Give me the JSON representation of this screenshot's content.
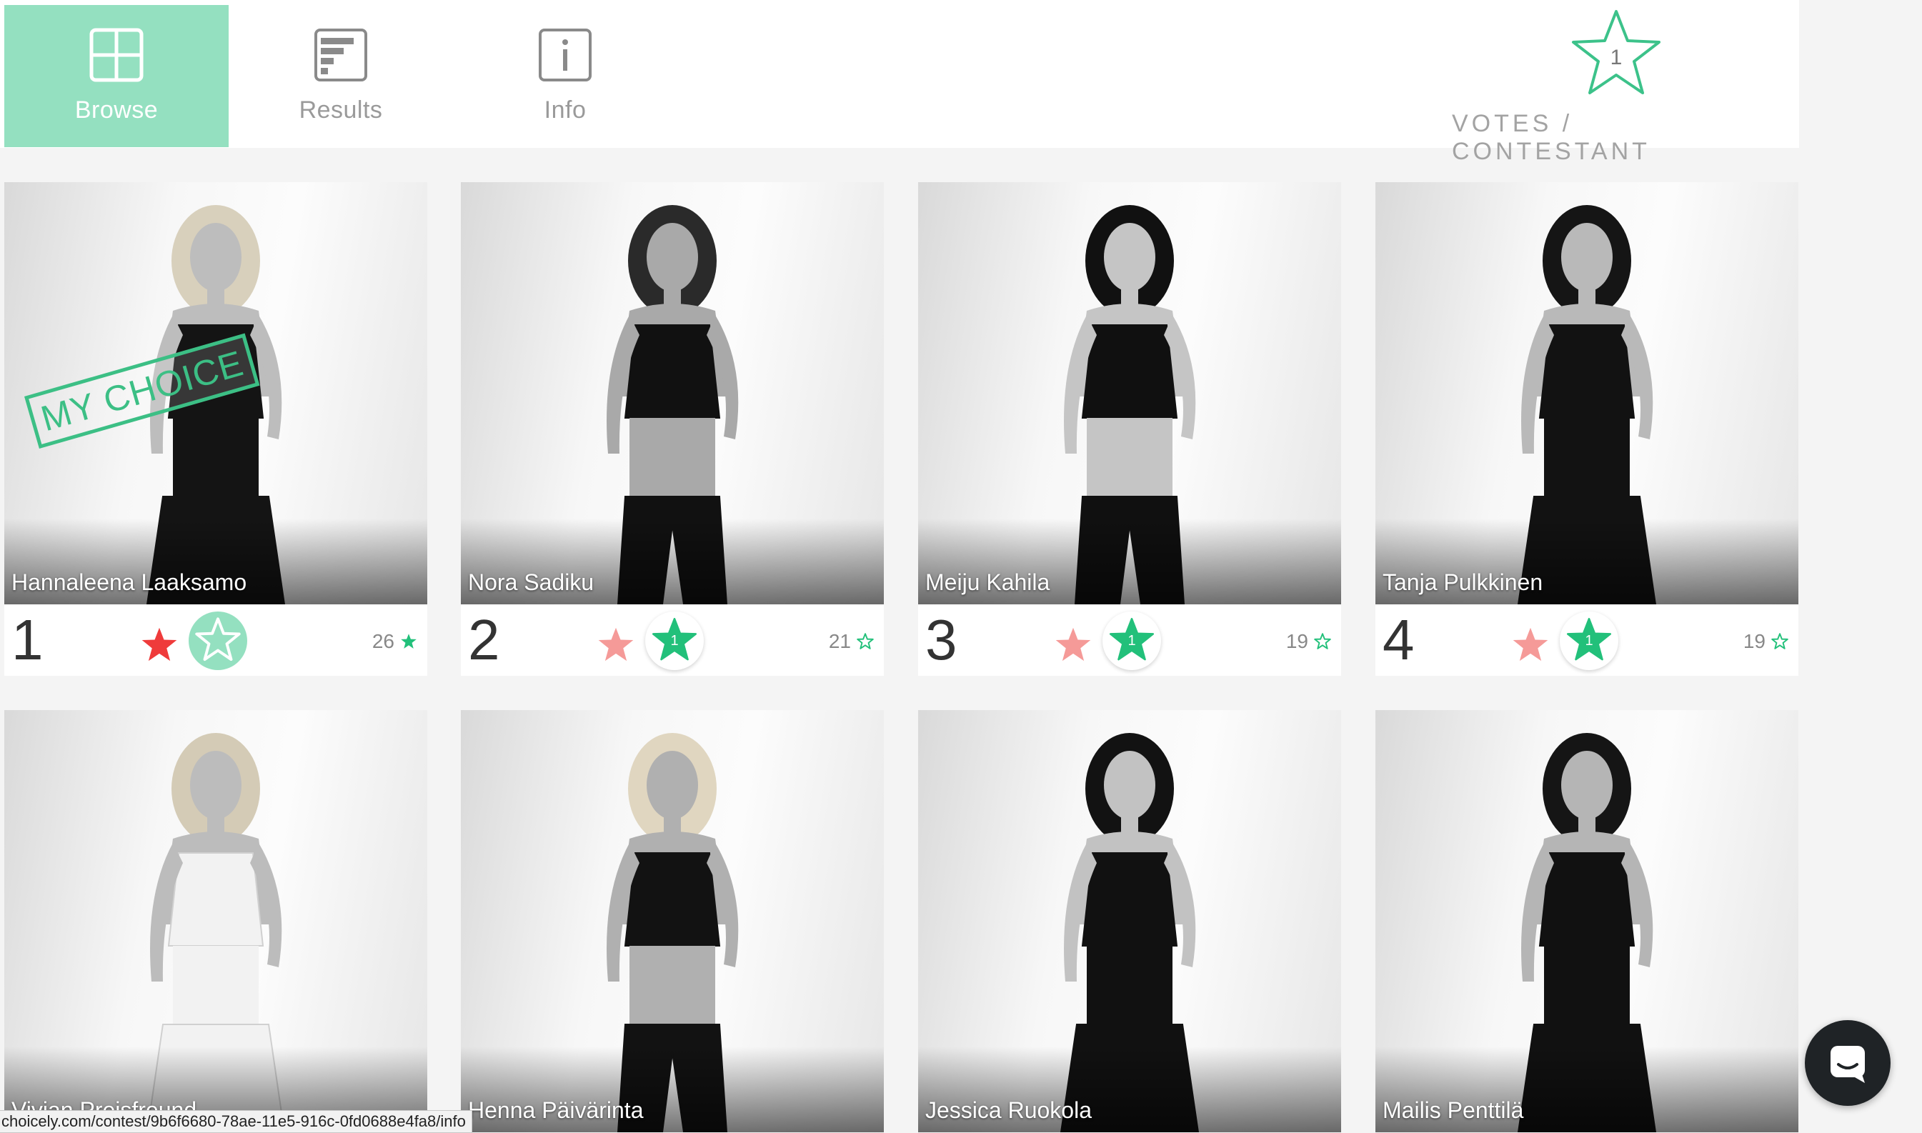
{
  "nav": {
    "tabs": [
      {
        "label": "Browse",
        "icon": "grid-icon",
        "active": true
      },
      {
        "label": "Results",
        "icon": "results-icon",
        "active": false
      },
      {
        "label": "Info",
        "icon": "info-icon",
        "active": false
      }
    ]
  },
  "votes": {
    "count": "1",
    "label": "VOTES / CONTESTANT"
  },
  "contestants": [
    {
      "rank": "1",
      "name": "Hannaleena Laaksamo",
      "votes": "26",
      "my_choice": true,
      "my_choice_label": "MY CHOICE",
      "vote_button": ""
    },
    {
      "rank": "2",
      "name": "Nora Sadiku",
      "votes": "21",
      "my_choice": false,
      "vote_button": "1"
    },
    {
      "rank": "3",
      "name": "Meiju Kahila",
      "votes": "19",
      "my_choice": false,
      "vote_button": "1"
    },
    {
      "rank": "4",
      "name": "Tanja Pulkkinen",
      "votes": "19",
      "my_choice": false,
      "vote_button": "1"
    },
    {
      "rank": "",
      "name": "Vivian Prejsfreund",
      "votes": "",
      "my_choice": false,
      "vote_button": ""
    },
    {
      "rank": "",
      "name": "Henna Päivärinta",
      "votes": "",
      "my_choice": false,
      "vote_button": ""
    },
    {
      "rank": "",
      "name": "Jessica Ruokola",
      "votes": "",
      "my_choice": false,
      "vote_button": ""
    },
    {
      "rank": "",
      "name": "Mailis Penttilä",
      "votes": "",
      "my_choice": false,
      "vote_button": ""
    }
  ],
  "status_bar": {
    "url": "choicely.com/contest/9b6f6680-78ae-11e5-916c-0fd0688e4fa8/info"
  },
  "chat": {
    "icon": "chat-icon"
  },
  "colors": {
    "accent": "#94e0c0",
    "accent_dark": "#22c07a",
    "star_red": "#ef3b3b",
    "star_pink": "#f59a98"
  }
}
